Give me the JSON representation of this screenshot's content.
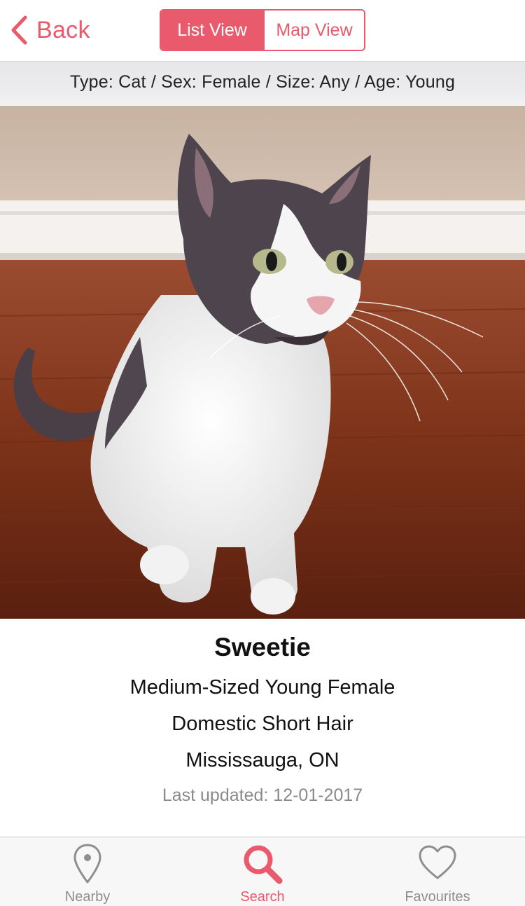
{
  "colors": {
    "accent": "#e85a6c",
    "inactive_tab": "#8e8e8e",
    "filter_bar_bg": "#ececee"
  },
  "nav": {
    "back_label": "Back",
    "back_icon": "chevron-left-icon",
    "segments": [
      {
        "label": "List View",
        "selected": true
      },
      {
        "label": "Map View",
        "selected": false
      }
    ]
  },
  "filter": {
    "summary": "Type: Cat / Sex: Female / Size: Any / Age: Young"
  },
  "pet": {
    "name": "Sweetie",
    "description": "Medium-Sized Young Female",
    "breed": "Domestic Short Hair",
    "location": "Mississauga, ON",
    "last_updated": "Last updated: 12-01-2017"
  },
  "tabs": [
    {
      "label": "Nearby",
      "icon": "map-pin-icon",
      "active": false
    },
    {
      "label": "Search",
      "icon": "search-icon",
      "active": true
    },
    {
      "label": "Favourites",
      "icon": "heart-icon",
      "active": false
    }
  ]
}
